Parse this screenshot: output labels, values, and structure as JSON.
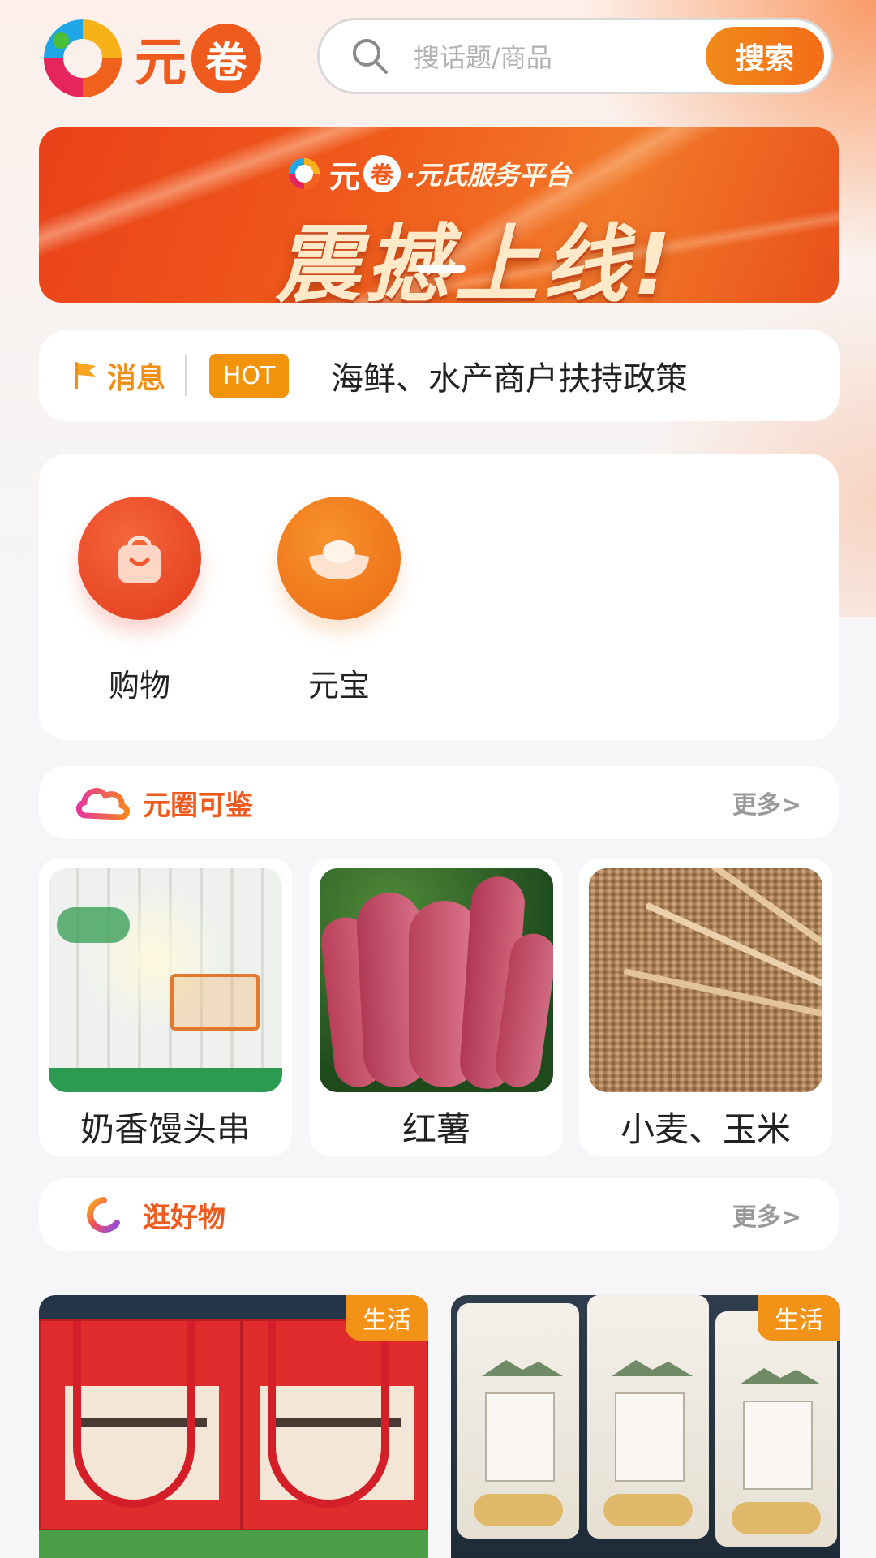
{
  "app": {
    "logo_char_1": "元",
    "logo_char_2": "卷",
    "colors": {
      "brand_orange": "#ef5a1e",
      "accent_orange": "#f2930c",
      "section_title": "#ef5a1e"
    }
  },
  "search": {
    "placeholder": "搜话题/商品",
    "button_label": "搜索",
    "icon": "search-icon"
  },
  "banner": {
    "mini_logo_char_1": "元",
    "mini_logo_char_2": "卷",
    "subtitle": "·元氏服务平台",
    "title": "震撼上线!"
  },
  "news": {
    "label": "消息",
    "badge": "HOT",
    "text": "海鲜、水产商户扶持政策",
    "icon": "flag-icon"
  },
  "shortcuts": [
    {
      "label": "购物",
      "icon": "shopping-bag-icon"
    },
    {
      "label": "元宝",
      "icon": "ingot-icon"
    }
  ],
  "section_yuanquan": {
    "title": "元圈可鉴",
    "more": "更多>",
    "icon": "cloud-icon",
    "items": [
      {
        "name": "奶香馒头串"
      },
      {
        "name": "红薯"
      },
      {
        "name": "小麦、玉米"
      }
    ]
  },
  "section_goods": {
    "title": "逛好物",
    "more": "更多>",
    "icon": "ring-icon",
    "items": [
      {
        "tag": "生活"
      },
      {
        "tag": "生活"
      }
    ]
  }
}
